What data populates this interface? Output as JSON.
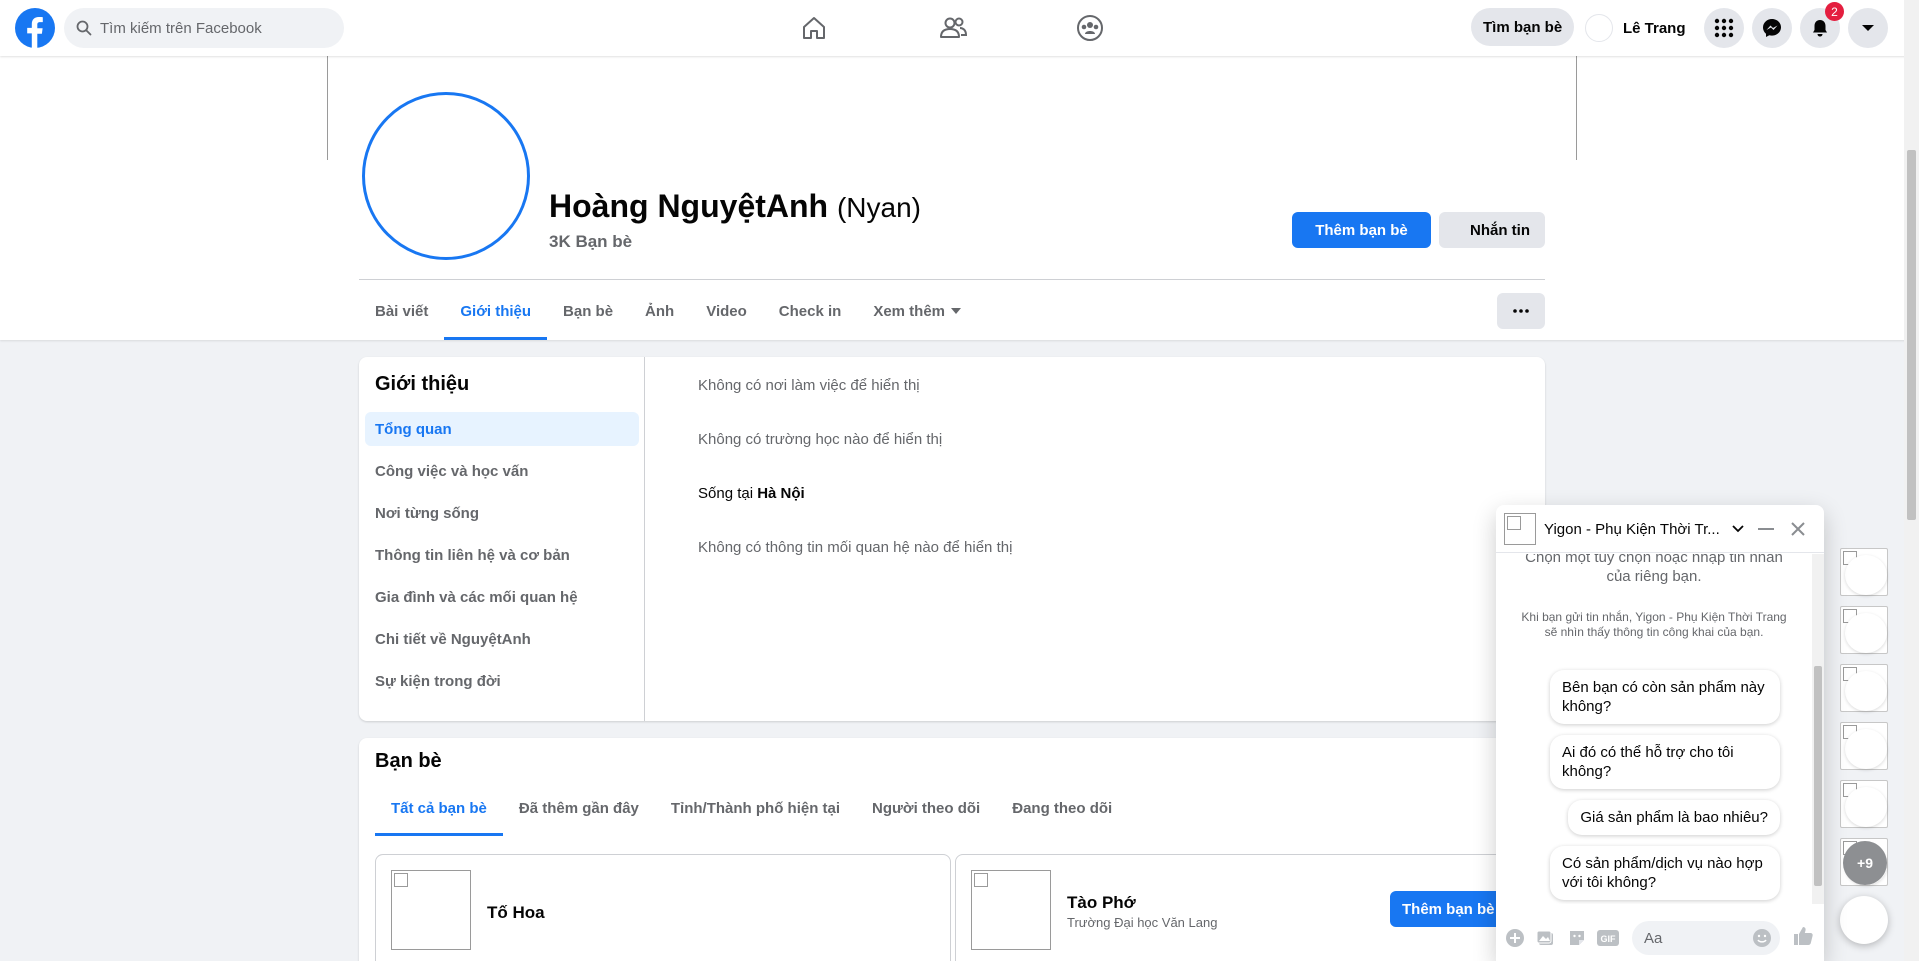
{
  "topnav": {
    "search_placeholder": "Tìm kiếm trên Facebook",
    "find_friends": "Tìm bạn bè",
    "user_name": "Lê Trang",
    "notification_count": "2"
  },
  "profile": {
    "name": "Hoàng NguyệtAnh",
    "alt_name": "(Nyan)",
    "friends_count": "3K Bạn bè",
    "add_friend": "Thêm bạn bè",
    "message": "Nhắn tin",
    "tabs": [
      "Bài viết",
      "Giới thiệu",
      "Bạn bè",
      "Ảnh",
      "Video",
      "Check in",
      "Xem thêm"
    ]
  },
  "about": {
    "title": "Giới thiệu",
    "nav": [
      "Tổng quan",
      "Công việc và học vấn",
      "Nơi từng sống",
      "Thông tin liên hệ và cơ bản",
      "Gia đình và các mối quan hệ",
      "Chi tiết về NguyệtAnh",
      "Sự kiện trong đời"
    ],
    "work": "Không có nơi làm việc để hiển thị",
    "school": "Không có trường học nào để hiển thị",
    "lives_prefix": "Sống tại ",
    "lives_city": "Hà Nội",
    "relationship": "Không có thông tin mối quan hệ nào để hiển thị"
  },
  "friends": {
    "title": "Bạn bè",
    "tabs": [
      "Tất cả bạn bè",
      "Đã thêm gần đây",
      "Tỉnh/Thành phố hiện tại",
      "Người theo dõi",
      "Đang theo dõi"
    ],
    "items": [
      {
        "name": "Tố Hoa",
        "sub": ""
      },
      {
        "name": "Tào Phớ",
        "sub": "Trường Đại học Văn Lang",
        "button": "Thêm bạn bè"
      }
    ]
  },
  "chat": {
    "title": "Yigon - Phụ Kiện Thời Tr...",
    "intro": "Chọn một tùy chọn hoặc nhập tin nhắn của riêng bạn.",
    "privacy": "Khi bạn gửi tin nhắn, Yigon - Phụ Kiện Thời Trang sẽ nhìn thấy thông tin công khai của bạn.",
    "chips": [
      "Bên bạn có còn sản phẩm này không?",
      "Ai đó có thể hỗ trợ cho tôi không?",
      "Giá sản phẩm là bao nhiêu?",
      "Có sản phẩm/dịch vụ nào hợp với tôi không?"
    ],
    "input_placeholder": "Aa"
  },
  "chat_heads": {
    "more_count": "+9"
  },
  "colors": {
    "brand": "#1877f2",
    "background": "#f0f2f5",
    "badge": "#e41e3f"
  },
  "icons": [
    "facebook-logo-icon",
    "search-icon",
    "home-icon",
    "friends-icon",
    "groups-icon",
    "menu-grid-icon",
    "messenger-icon",
    "bell-icon",
    "caret-down-icon",
    "more-dots-icon",
    "minimize-icon",
    "close-icon",
    "plus-circle-icon",
    "photo-icon",
    "sticker-icon",
    "gif-icon",
    "emoji-icon",
    "like-icon"
  ]
}
